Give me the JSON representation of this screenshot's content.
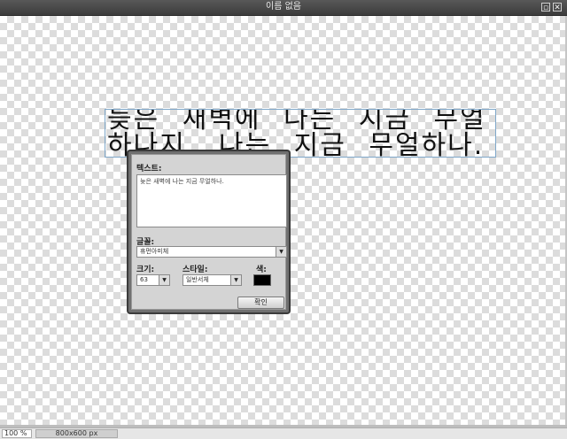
{
  "window": {
    "title": "이름 없음",
    "restore_glyph": "▫",
    "close_glyph": "✕"
  },
  "canvas": {
    "text_layer": "늦은 새벽에 나는 지금 무얼하나지. 나는 지금 무얼하나."
  },
  "text_dialog": {
    "text_label": "텍스트:",
    "text_value": "늦은 새벽에 나는 지금 무얼하나.",
    "font_label": "글꼴:",
    "font_value": "휴먼아미체",
    "size_label": "크기:",
    "size_value": "63",
    "style_label": "스타일:",
    "style_value": "일반서체",
    "color_label": "색:",
    "color_value": "#000000",
    "ok_label": "확인",
    "dropdown_glyph": "▼"
  },
  "status_bar": {
    "zoom": "100 %",
    "image_size": "800x600 px"
  }
}
